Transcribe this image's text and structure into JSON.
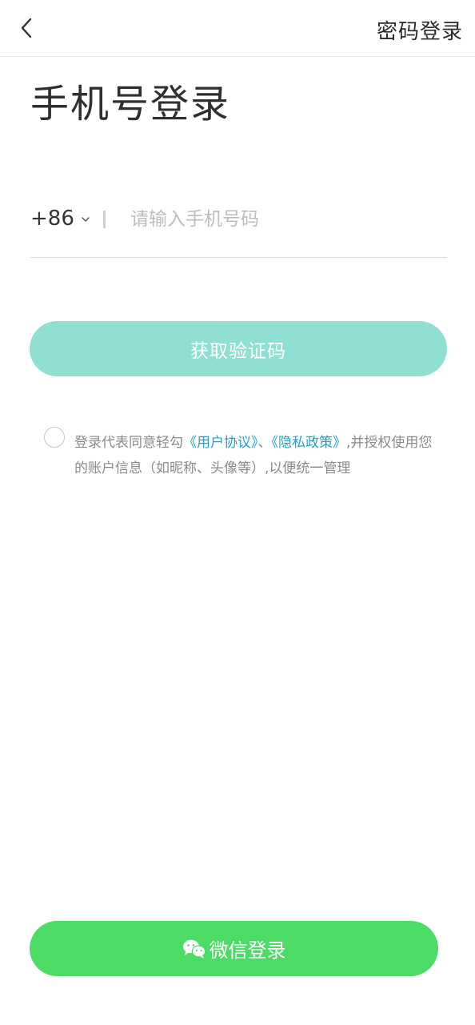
{
  "header": {
    "back_icon": "chevron-left-icon",
    "password_login": "密码登录"
  },
  "title": "手机号登录",
  "phone": {
    "country_code": "+86",
    "placeholder": "请输入手机号码",
    "value": ""
  },
  "get_code_button": "获取验证码",
  "agreement": {
    "prefix": "登录代表同意轻勾",
    "user_agreement": "《用户协议》",
    "separator": "、",
    "privacy_policy": "《隐私政策》",
    "suffix": ",并授权使用您的账户信息（如昵称、头像等）,以便统一管理"
  },
  "wechat_login_button": "微信登录",
  "colors": {
    "code_button": "#8fe0d2",
    "wechat_button": "#4cdc66",
    "link": "#1e9fd0"
  }
}
